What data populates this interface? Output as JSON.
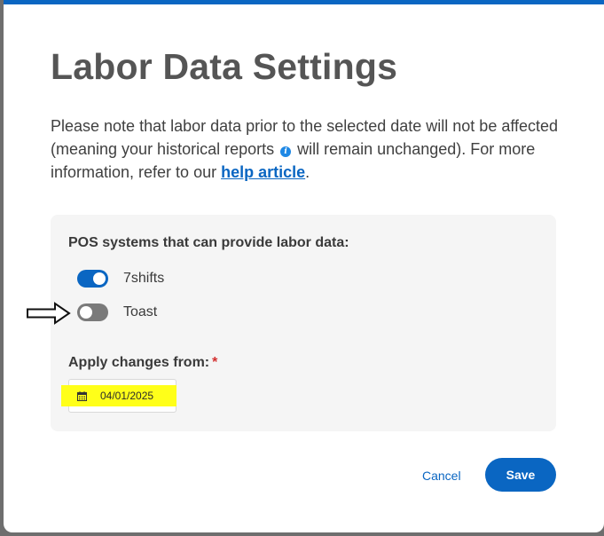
{
  "modal": {
    "title": "Labor Data Settings",
    "description": {
      "before_icon": "Please note that labor data prior to the selected date will not be affected (meaning your historical reports",
      "after_icon": "will remain unchanged). For more information, refer to our",
      "link_text": "help article",
      "end": "."
    },
    "info_icon": "info-icon"
  },
  "panel": {
    "heading": "POS systems that can provide labor data:",
    "pos_systems": [
      {
        "label": "7shifts",
        "enabled": true
      },
      {
        "label": "Toast",
        "enabled": false
      }
    ],
    "apply_label": "Apply changes from:",
    "required_marker": "*",
    "date_value": "04/01/2025",
    "date_icon": "calendar-icon"
  },
  "footer": {
    "cancel_label": "Cancel",
    "save_label": "Save"
  },
  "annotations": {
    "arrow_icon": "arrow-right-icon",
    "highlight_color": "#ffff19"
  },
  "colors": {
    "accent": "#0a66c2",
    "toggle_off": "#7a7a7a",
    "panel_bg": "#f5f5f5",
    "required": "#d32f2f"
  }
}
